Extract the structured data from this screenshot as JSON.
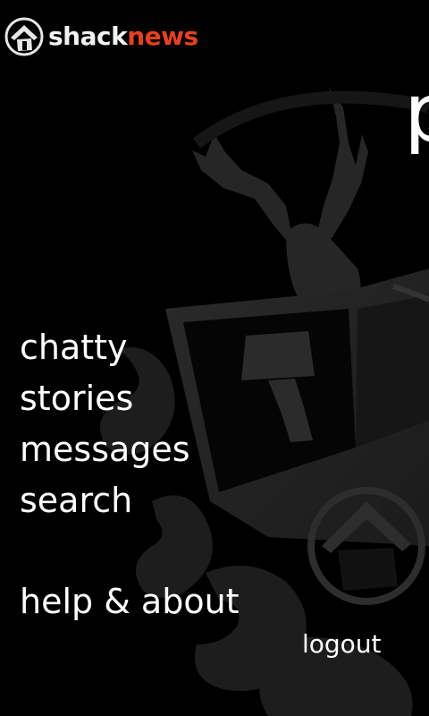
{
  "app": {
    "brand_part1": "shack",
    "brand_part2": "news",
    "title_fragment": "p"
  },
  "menu": {
    "items": [
      {
        "label": "chatty"
      },
      {
        "label": "stories"
      },
      {
        "label": "messages"
      },
      {
        "label": "search"
      },
      {
        "label": "help & about"
      }
    ]
  },
  "footer": {
    "logout_label": "logout"
  },
  "colors": {
    "background": "#000000",
    "brand_accent": "#e8401c",
    "text": "#ffffff"
  }
}
